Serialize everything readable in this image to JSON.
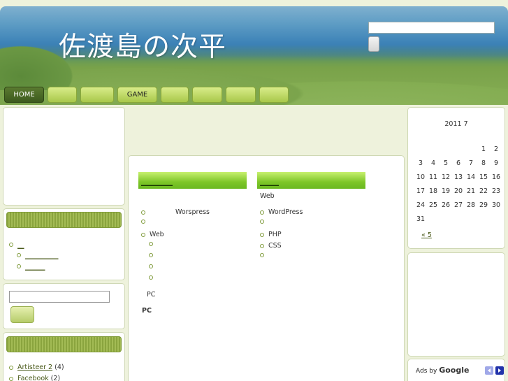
{
  "header": {
    "title": "佐渡島の次平",
    "search_value": "",
    "search_button": ""
  },
  "nav": [
    {
      "label": "HOME",
      "active": true
    },
    {
      "label": ""
    },
    {
      "label": ""
    },
    {
      "label": "GAME"
    },
    {
      "label": ""
    },
    {
      "label": ""
    },
    {
      "label": ""
    },
    {
      "label": ""
    }
  ],
  "left": {
    "categories": [
      {
        "label": "＿"
      },
      {
        "label": "＿＿＿＿＿"
      },
      {
        "label": "＿＿＿"
      }
    ],
    "search_value": "",
    "links": [
      {
        "label": "Artisteer 2",
        "count": "(4)"
      },
      {
        "label": "Facebook",
        "count": "(2)"
      }
    ]
  },
  "center": {
    "col1": {
      "header": "＿＿＿＿＿",
      "items": [
        "Worspress",
        "",
        "Web",
        "",
        "",
        "",
        ""
      ],
      "footer1": "PC",
      "footer2": "PC"
    },
    "col2": {
      "header": "＿＿＿",
      "intro": "Web",
      "items": [
        "WordPress",
        "",
        "PHP",
        "CSS",
        ""
      ]
    }
  },
  "calendar": {
    "title": "2011 7",
    "days": [
      "1",
      "2",
      "3",
      "4",
      "5",
      "6",
      "7",
      "8",
      "9",
      "10",
      "11",
      "12",
      "13",
      "14",
      "15",
      "16",
      "17",
      "18",
      "19",
      "20",
      "21",
      "22",
      "23",
      "24",
      "25",
      "26",
      "27",
      "28",
      "29",
      "30",
      "31"
    ],
    "prev": "« 5"
  },
  "ads": {
    "label": "Ads by",
    "brand": "Google"
  }
}
